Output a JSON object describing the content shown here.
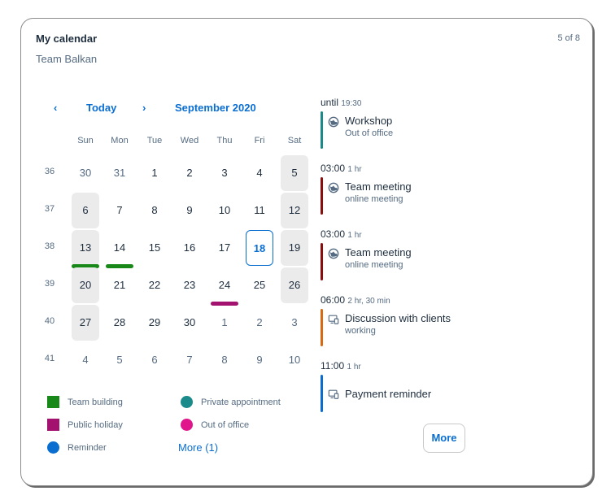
{
  "card": {
    "title": "My calendar",
    "subtitle": "Team Balkan",
    "counter": "5 of 8"
  },
  "nav": {
    "prev": "‹",
    "today": "Today",
    "next": "›",
    "month": "September 2020"
  },
  "weekdays": [
    "Sun",
    "Mon",
    "Tue",
    "Wed",
    "Thu",
    "Fri",
    "Sat"
  ],
  "weeks": [
    {
      "no": "36",
      "days": [
        "30",
        "31",
        "1",
        "2",
        "3",
        "4",
        "5"
      ]
    },
    {
      "no": "37",
      "days": [
        "6",
        "7",
        "8",
        "9",
        "10",
        "11",
        "12"
      ]
    },
    {
      "no": "38",
      "days": [
        "13",
        "14",
        "15",
        "16",
        "17",
        "18",
        "19"
      ]
    },
    {
      "no": "39",
      "days": [
        "20",
        "21",
        "22",
        "23",
        "24",
        "25",
        "26"
      ]
    },
    {
      "no": "40",
      "days": [
        "27",
        "28",
        "29",
        "30",
        "1",
        "2",
        "3"
      ]
    },
    {
      "no": "41",
      "days": [
        "4",
        "5",
        "6",
        "7",
        "8",
        "9",
        "10"
      ]
    }
  ],
  "selected_day": "18",
  "legend": [
    {
      "label": "Team building",
      "color": "#188918",
      "shape": "square"
    },
    {
      "label": "Private appointment",
      "color": "#1b8a8a",
      "shape": "circle"
    },
    {
      "label": "Public holiday",
      "color": "#a3126e",
      "shape": "square"
    },
    {
      "label": "Out of office",
      "color": "#e0158c",
      "shape": "circle"
    },
    {
      "label": "Reminder",
      "color": "#0a6ed1",
      "shape": "circle"
    }
  ],
  "legend_more": "More (1)",
  "appointments": [
    {
      "time": "until",
      "dur": "19:30",
      "name": "Workshop",
      "desc": "Out of office",
      "color": "#1b8a8a",
      "icon": "globe-icon"
    },
    {
      "time": "03:00",
      "dur": "1 hr",
      "name": "Team meeting",
      "desc": "online meeting",
      "color": "#8b0e0e",
      "icon": "globe-icon"
    },
    {
      "time": "03:00",
      "dur": "1 hr",
      "name": "Team meeting",
      "desc": "online meeting",
      "color": "#8b0e0e",
      "icon": "globe-icon"
    },
    {
      "time": "06:00",
      "dur": "2 hr, 30 min",
      "name": "Discussion with clients",
      "desc": "working",
      "color": "#d66a12",
      "icon": "devices-icon"
    },
    {
      "time": "11:00",
      "dur": "1 hr",
      "name": "Payment reminder",
      "desc": "",
      "color": "#0a6ed1",
      "icon": "devices-icon"
    }
  ],
  "more_button": "More"
}
